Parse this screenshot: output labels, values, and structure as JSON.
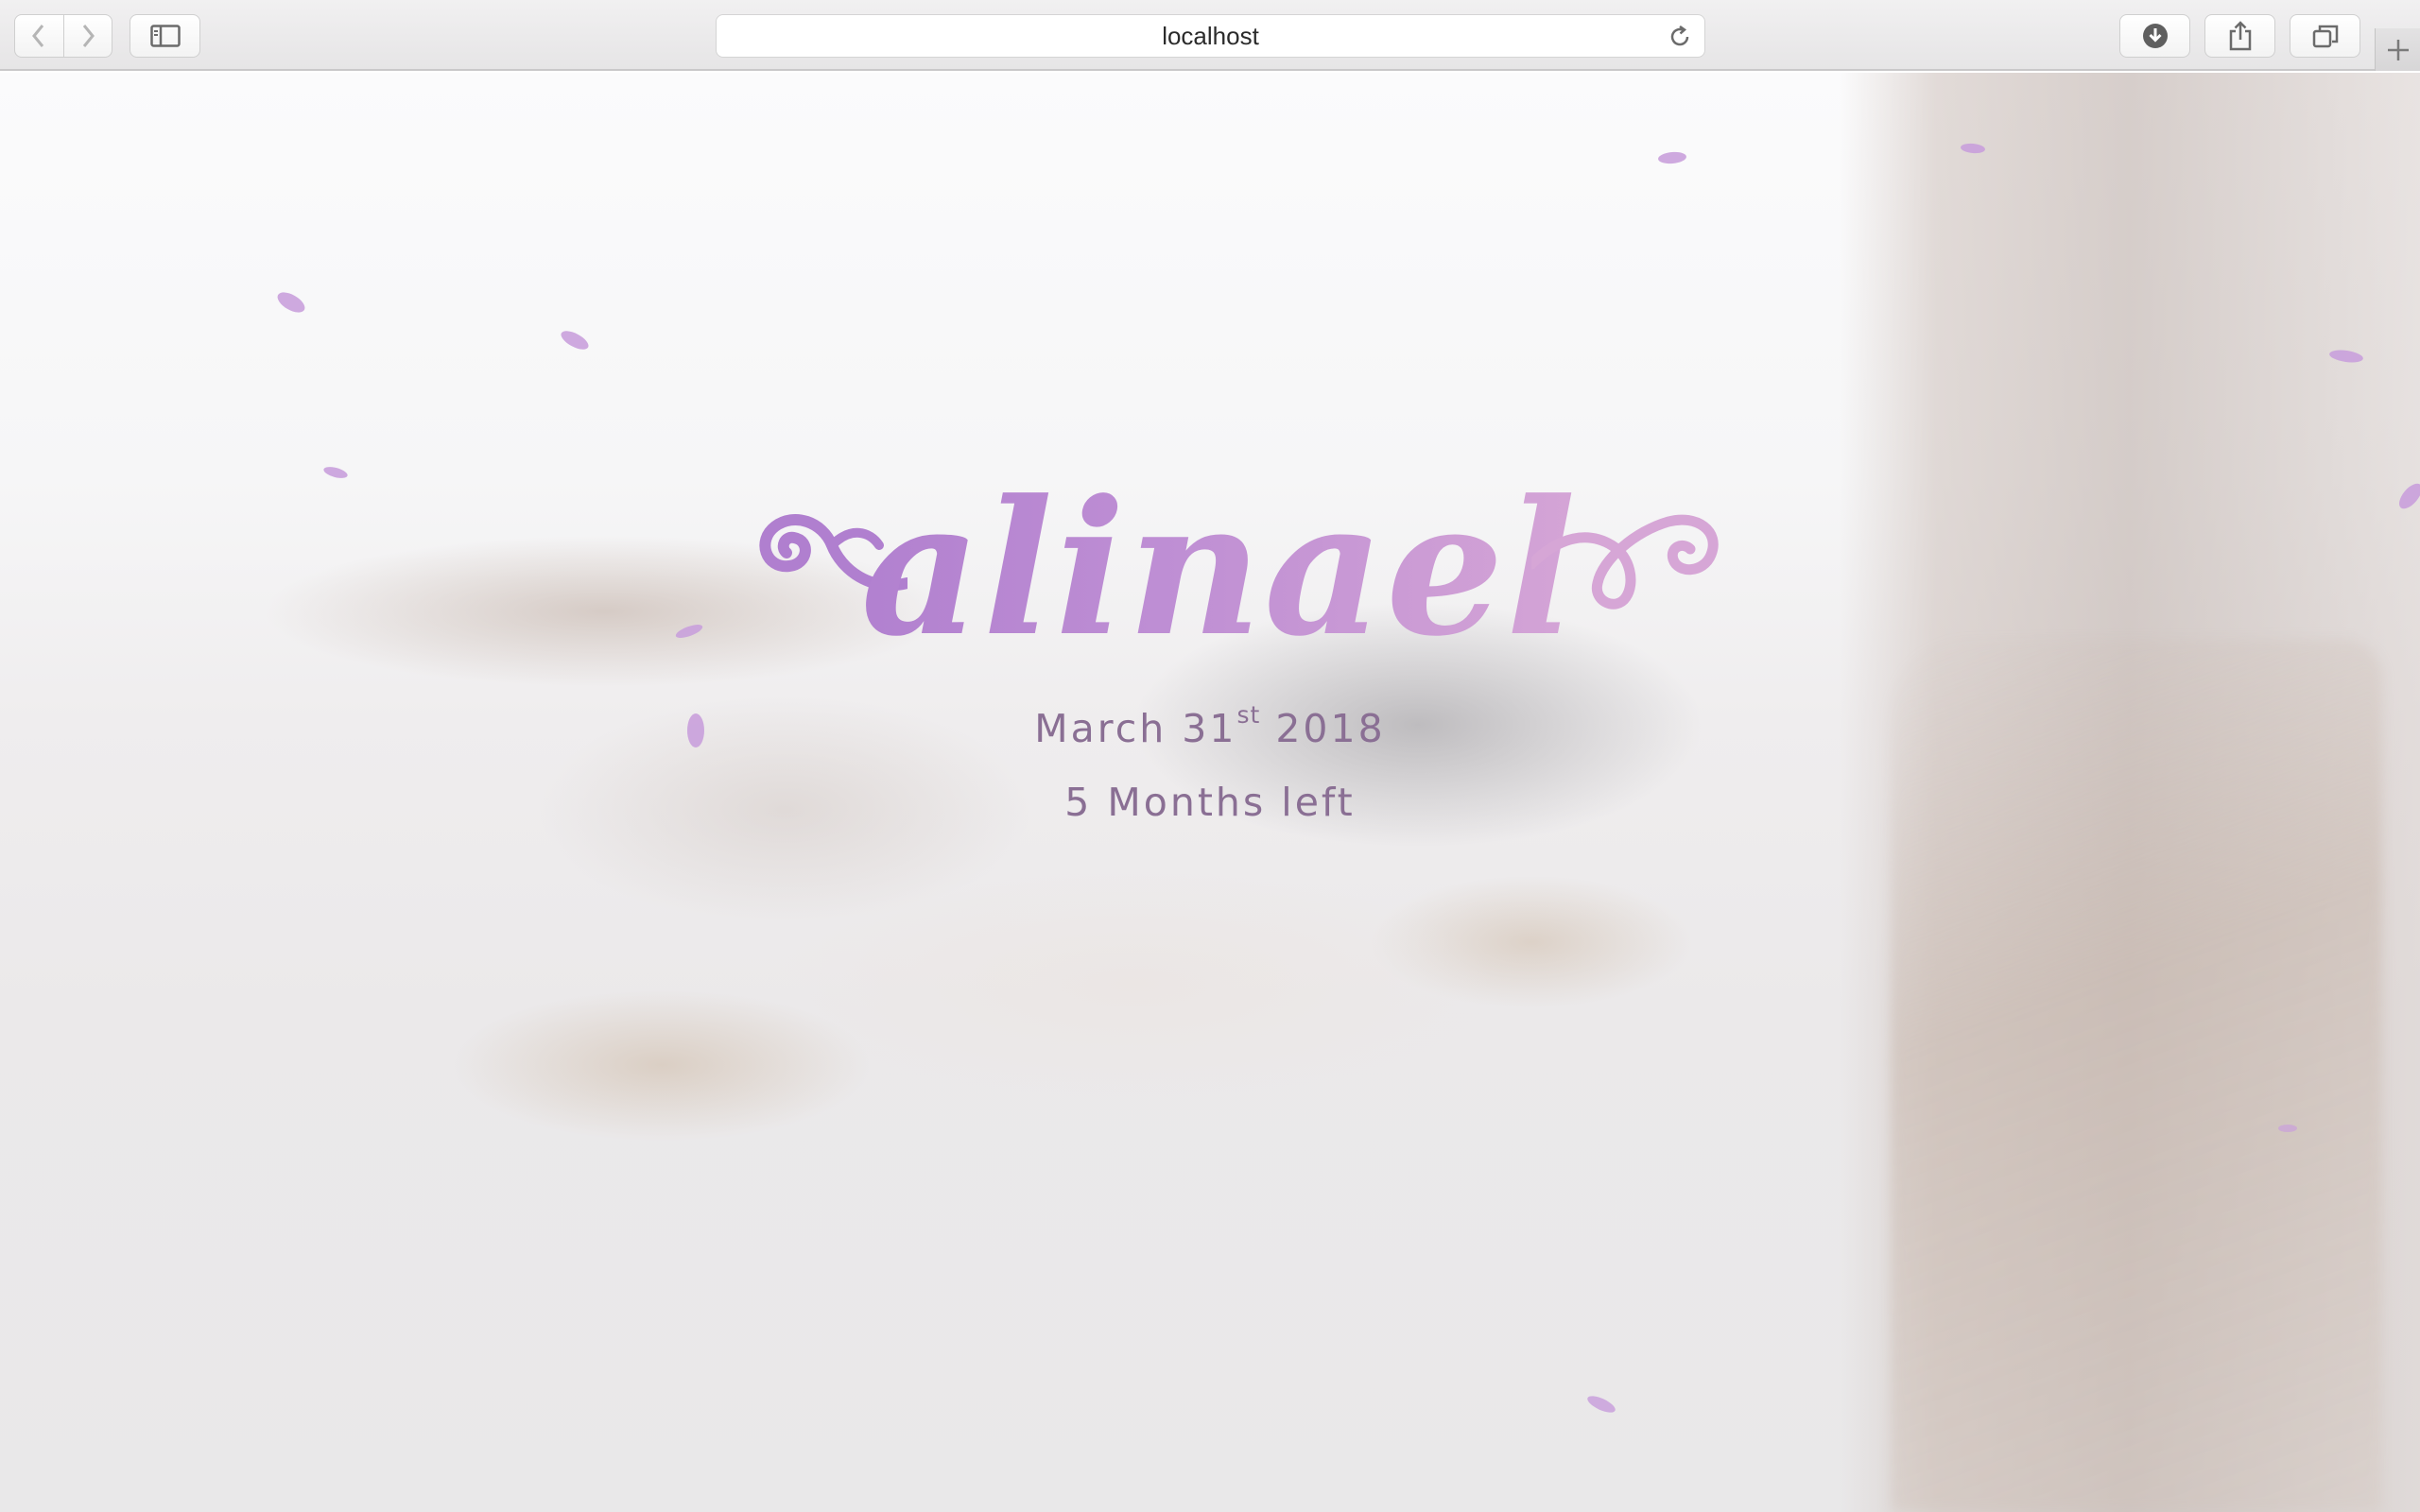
{
  "browser": {
    "url": "localhost",
    "icons": {
      "back": "chevron-left-icon",
      "forward": "chevron-right-icon",
      "sidebar": "sidebar-icon",
      "reload": "reload-icon",
      "downloads": "download-icon",
      "share": "share-icon",
      "tabs": "tabs-overview-icon",
      "new_tab": "plus-icon"
    }
  },
  "hero": {
    "logo_text": "alinael",
    "date_main": "March 31",
    "date_suffix": "st",
    "date_year": " 2018",
    "countdown": "5 Months left"
  },
  "colors": {
    "accent": "#b98ad3",
    "text": "#8a6f94",
    "petal": "#c9a0dc"
  }
}
